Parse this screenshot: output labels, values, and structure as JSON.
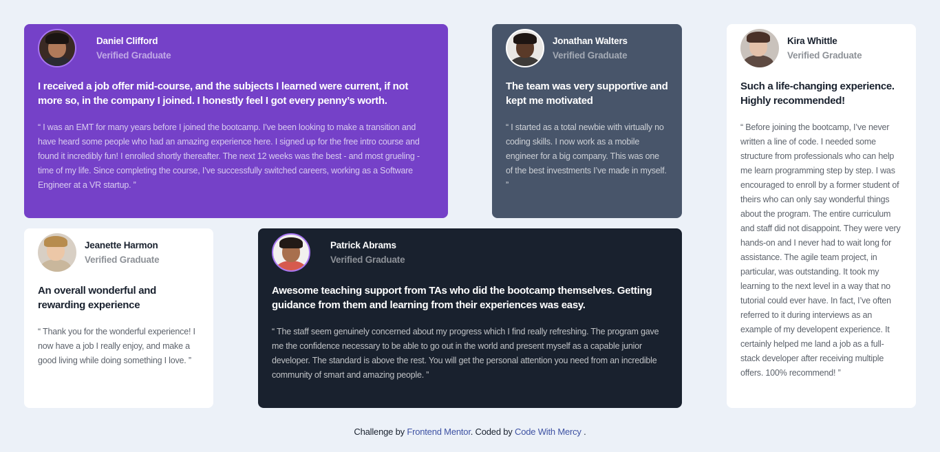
{
  "testimonials": [
    {
      "name": "Daniel Clifford",
      "role": "Verified Graduate",
      "summary": "I received a job offer mid-course, and the subjects I learned were current, if not more so, in the company I joined. I honestly feel I got every penny’s worth.",
      "quote": "“ I was an EMT for many years before I joined the bootcamp. I’ve been looking to make a transition and have heard some people who had an amazing experience here. I signed up for the free intro course and found it incredibly fun! I enrolled shortly thereafter. The next 12 weeks was the best - and most grueling - time of my life. Since completing the course, I’ve successfully switched careers, working as a Software Engineer at a VR startup. ”"
    },
    {
      "name": "Jonathan Walters",
      "role": "Verified Graduate",
      "summary": "The team was very supportive and kept me motivated",
      "quote": "“ I started as a total newbie with virtually no coding skills. I now work as a mobile engineer for a big company. This was one of the best investments I’ve made in myself. ”"
    },
    {
      "name": "Kira Whittle",
      "role": "Verified Graduate",
      "summary": "Such a life-changing experience. Highly recommended!",
      "quote": "“ Before joining the bootcamp, I’ve never written a line of code. I needed some structure from professionals who can help me learn programming step by step. I was encouraged to enroll by a former student of theirs who can only say wonderful things about the program. The entire curriculum and staff did not disappoint. They were very hands-on and I never had to wait long for assistance. The agile team project, in particular, was outstanding. It took my learning to the next level in a way that no tutorial could ever have. In fact, I’ve often referred to it during interviews as an example of my developent experience. It certainly helped me land a job as a full-stack developer after receiving multiple offers. 100% recommend! ”"
    },
    {
      "name": "Jeanette Harmon",
      "role": "Verified Graduate",
      "summary": "An overall wonderful and rewarding experience",
      "quote": "“ Thank you for the wonderful experience! I now have a job I really enjoy, and make a good living while doing something I love. ”"
    },
    {
      "name": "Patrick Abrams",
      "role": "Verified Graduate",
      "summary": "Awesome teaching support from TAs who did the bootcamp themselves. Getting guidance from them and learning from their experiences was easy.",
      "quote": "“ The staff seem genuinely concerned about my progress which I find really refreshing. The program gave me the confidence necessary to be able to go out in the world and present myself as a capable junior developer. The standard is above the rest. You will get the personal attention you need from an incredible community of smart and amazing people. ”"
    }
  ],
  "footer": {
    "prefix": "Challenge by",
    "link1": "Frontend Mentor",
    "middle": ". Coded by",
    "link2": "Code With Mercy",
    "suffix": "."
  },
  "colors": {
    "purple": "#7541c8",
    "slate": "#48556a",
    "dark": "#19212e",
    "background": "#ecf1f8",
    "link": "#3e52a3"
  }
}
